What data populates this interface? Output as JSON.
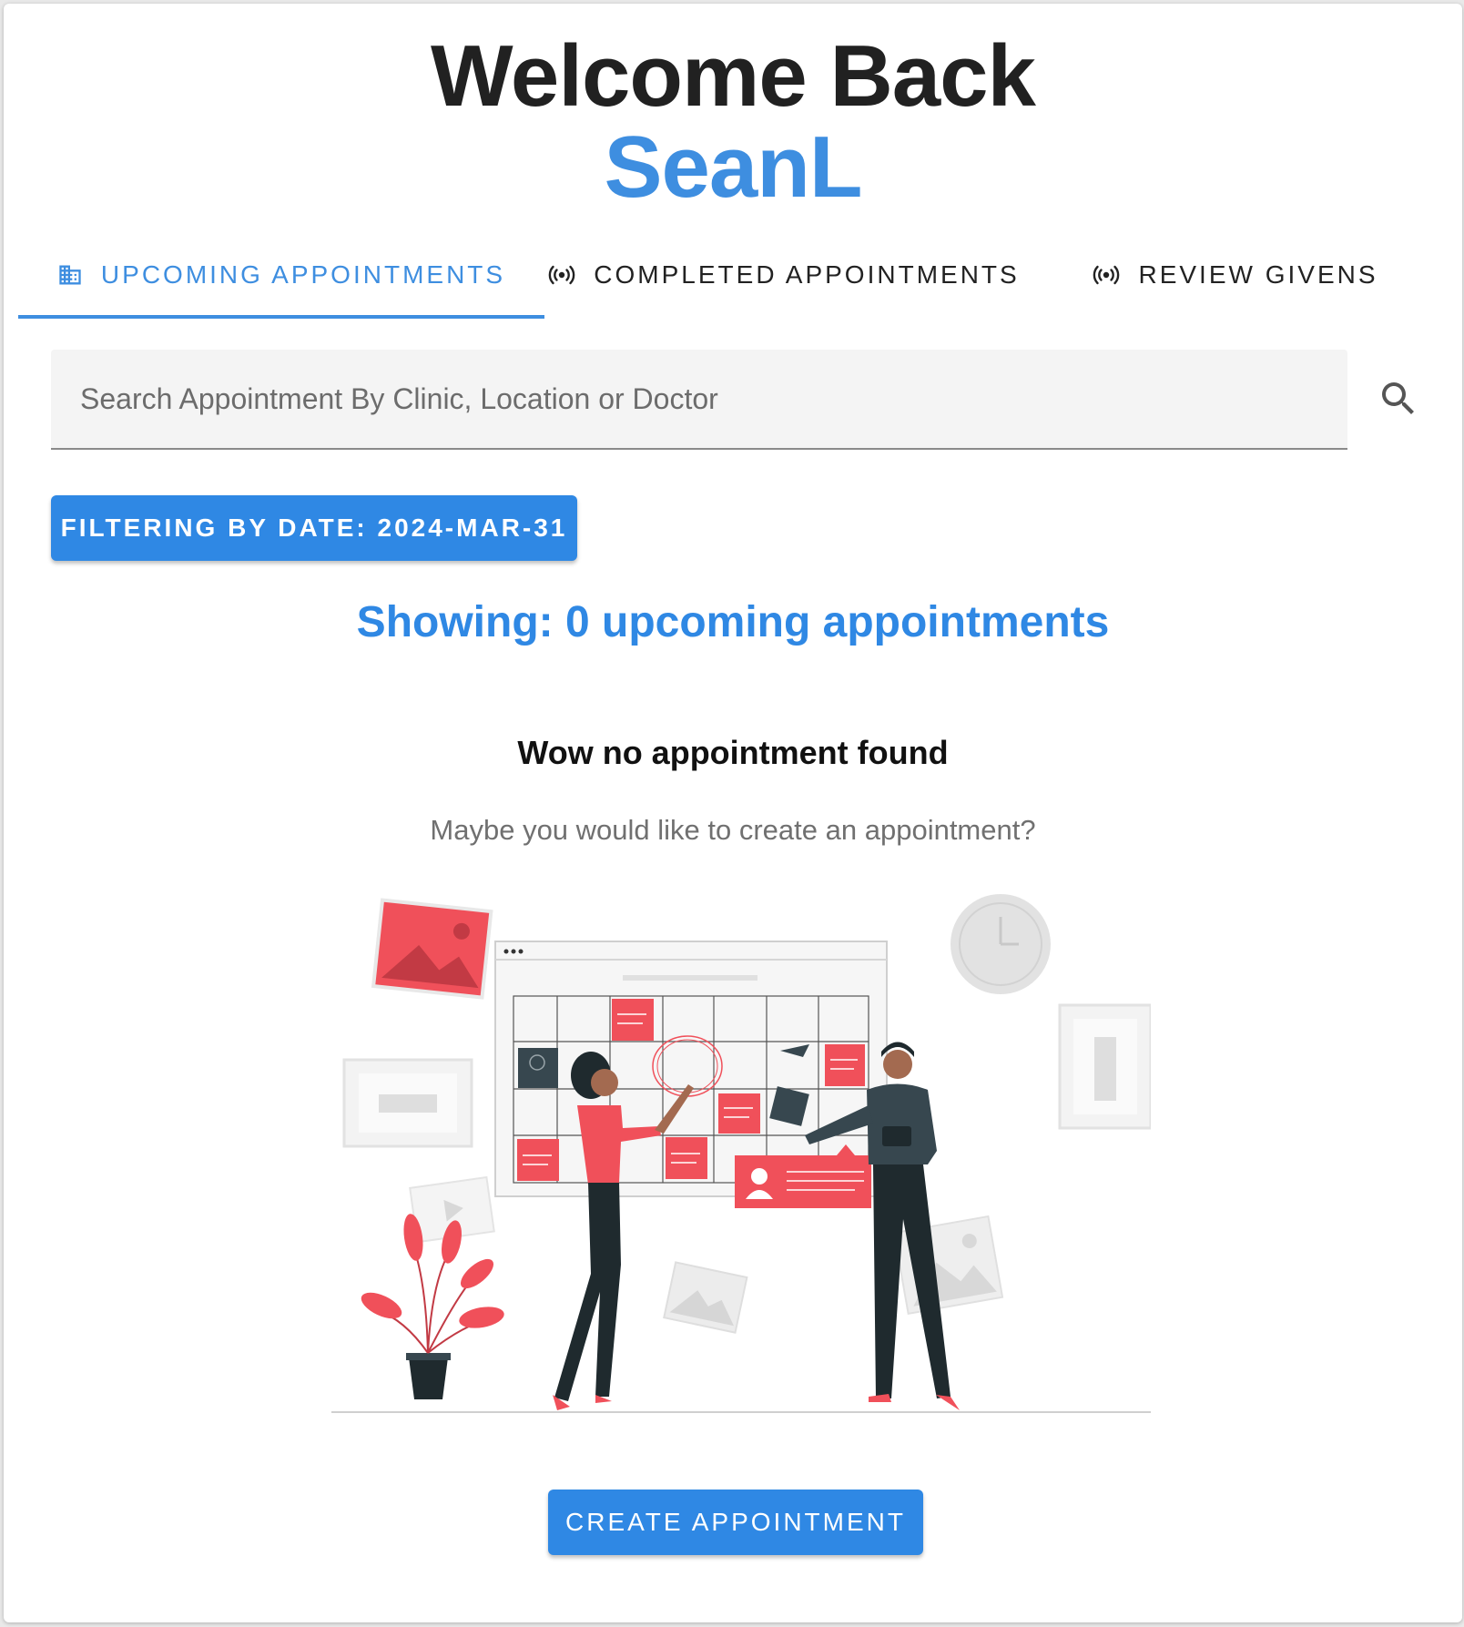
{
  "header": {
    "greeting": "Welcome Back",
    "username": "SeanL"
  },
  "tabs": [
    {
      "label": "UPCOMING APPOINTMENTS",
      "icon": "building-icon",
      "active": true
    },
    {
      "label": "COMPLETED APPOINTMENTS",
      "icon": "broadcast-icon",
      "active": false
    },
    {
      "label": "REVIEW GIVENS",
      "icon": "broadcast-icon",
      "active": false
    }
  ],
  "search": {
    "placeholder": "Search Appointment By Clinic, Location or Doctor",
    "value": "",
    "icon": "search-icon"
  },
  "filter": {
    "label": "FILTERING BY DATE: 2024-MAR-31"
  },
  "summary": {
    "text": "Showing: 0 upcoming appointments"
  },
  "empty_state": {
    "title": "Wow no appointment found",
    "subtitle": "Maybe you would like to create an appointment?",
    "illustration": "calendar-planning-illustration"
  },
  "actions": {
    "create_label": "CREATE APPOINTMENT"
  },
  "colors": {
    "primary": "#2f88e4",
    "accent_text": "#3e8ee0",
    "illustration_red": "#f0505a",
    "illustration_dark": "#1f2a2e"
  }
}
